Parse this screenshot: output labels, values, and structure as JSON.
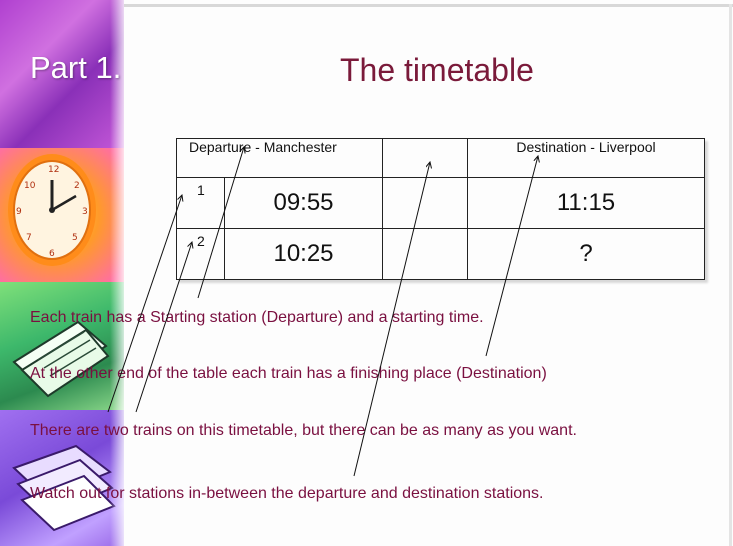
{
  "slide": {
    "part_label": "Part 1.",
    "title": "The timetable"
  },
  "timetable": {
    "header": {
      "departure": "Departure  - Manchester",
      "destination": "Destination  - Liverpool"
    },
    "rows": [
      {
        "num": "1",
        "departure_time": "09:55",
        "arrival_time": "11:15"
      },
      {
        "num": "2",
        "departure_time": "10:25",
        "arrival_time": "?"
      }
    ]
  },
  "bullets": [
    "Each train  has a Starting  station  (Departure)  and a starting  time.",
    "At the other  end of the table each train  has a finishing  place (Destination)",
    "There are two trains  on this timetable,  but there can be as many as you want.",
    "Watch out  for stations  in-between  the departure  and destination  stations."
  ],
  "colors": {
    "title": "#7a1a3a",
    "bullet_text": "#7a1040",
    "part_label": "#ffffff"
  },
  "decorations": [
    "clock-image",
    "papers-image",
    "books-image"
  ]
}
